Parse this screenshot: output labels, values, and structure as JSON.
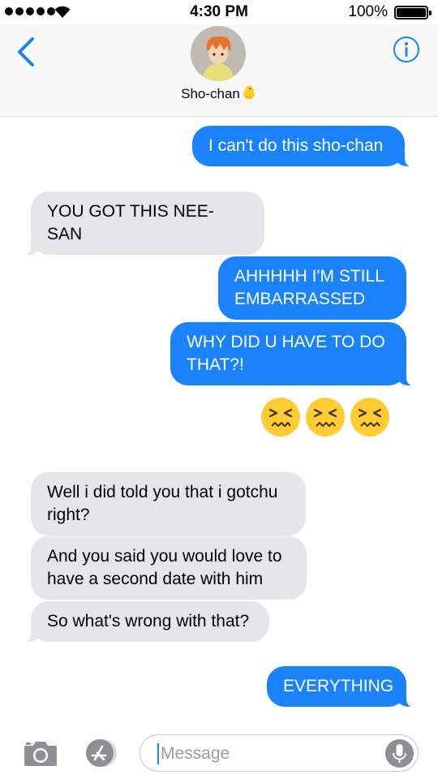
{
  "status_bar": {
    "time": "4:30 PM",
    "battery": "100%"
  },
  "header": {
    "contact_name": "Sho-chan"
  },
  "messages": [
    {
      "text": "I can't do this sho-chan"
    },
    {
      "text": "YOU GOT THIS NEE-SAN"
    },
    {
      "text": "AHHHHH I'M STILL EMBARRASSED"
    },
    {
      "text": "WHY DID U HAVE TO DO THAT?!"
    },
    {
      "text": "Well i did told you that i gotchu right?"
    },
    {
      "text": "And you said you would love to have a second date with him"
    },
    {
      "text": "So what's wrong with that?"
    },
    {
      "text": "EVERYTHING"
    }
  ],
  "emoji_reply": {
    "icons": [
      "confounded-face-icon",
      "confounded-face-icon",
      "confounded-face-icon"
    ]
  },
  "input_bar": {
    "placeholder": "Message"
  },
  "colors": {
    "outgoing": "#1a82fb",
    "incoming": "#e5e5ea",
    "accent": "#1a82fb"
  }
}
